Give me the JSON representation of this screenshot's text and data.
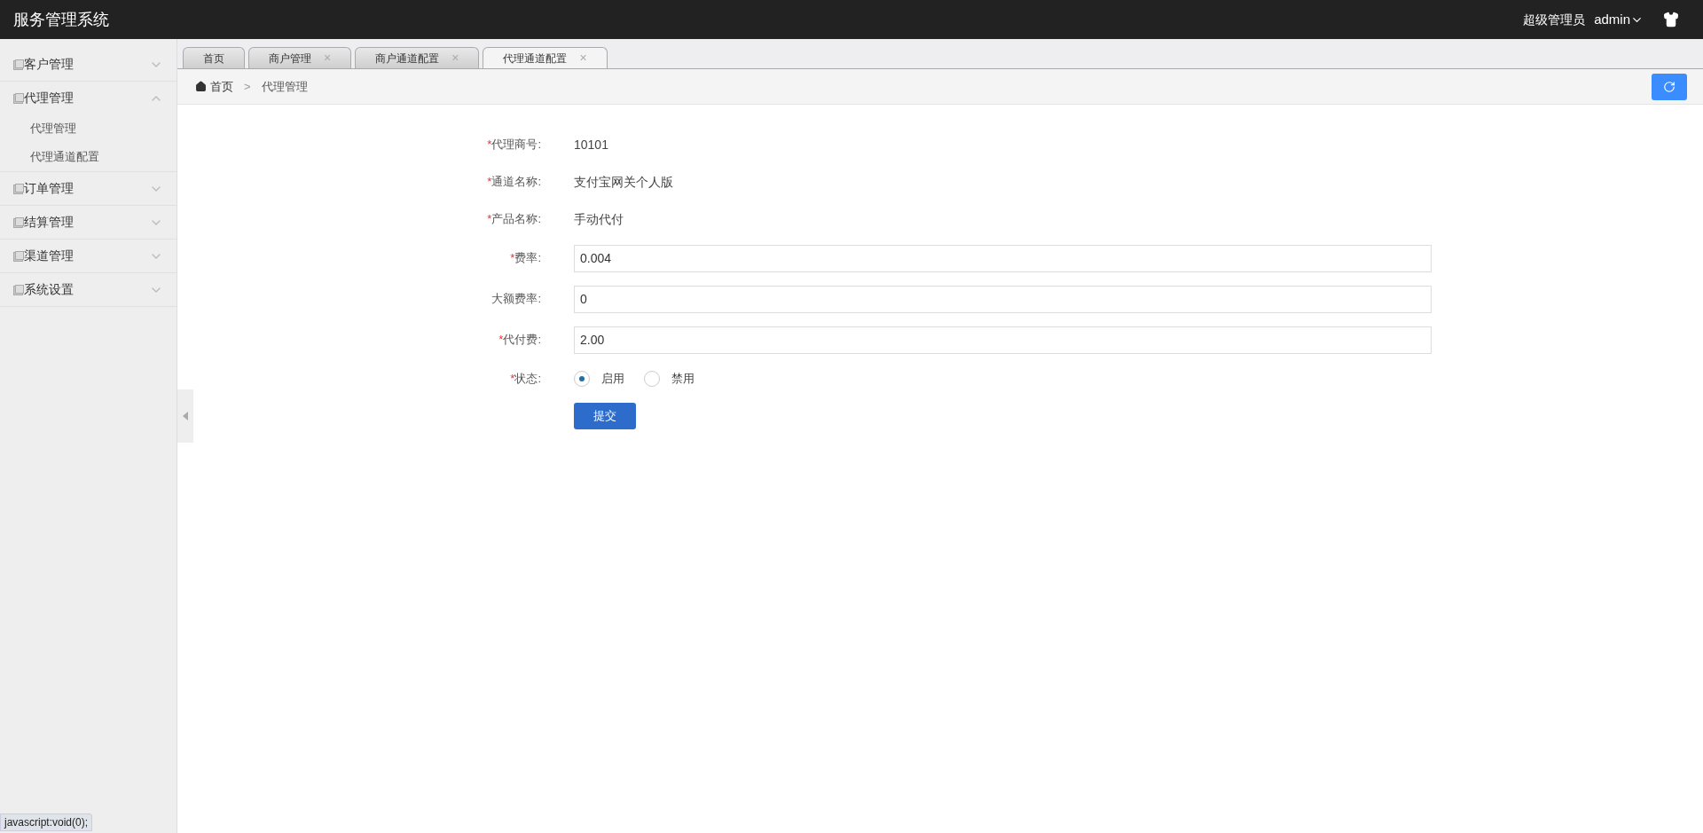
{
  "header": {
    "title": "服务管理系统",
    "role": "超级管理员",
    "user": "admin"
  },
  "sidebar": {
    "items": [
      {
        "label": "客户管理",
        "expanded": false
      },
      {
        "label": "代理管理",
        "expanded": true,
        "children": [
          {
            "label": "代理管理"
          },
          {
            "label": "代理通道配置"
          }
        ]
      },
      {
        "label": "订单管理",
        "expanded": false
      },
      {
        "label": "结算管理",
        "expanded": false
      },
      {
        "label": "渠道管理",
        "expanded": false
      },
      {
        "label": "系统设置",
        "expanded": false
      }
    ]
  },
  "tabs": [
    {
      "label": "首页",
      "closable": false,
      "selected": false
    },
    {
      "label": "商户管理",
      "closable": true,
      "selected": false
    },
    {
      "label": "商户通道配置",
      "closable": true,
      "selected": false
    },
    {
      "label": "代理通道配置",
      "closable": true,
      "selected": true
    }
  ],
  "close_glyph": "×",
  "breadcrumb": {
    "home": "首页",
    "separator": ">",
    "current": "代理管理"
  },
  "form": {
    "fields": [
      {
        "kind": "text",
        "label": "代理商号:",
        "required": true,
        "value": "10101"
      },
      {
        "kind": "text",
        "label": "通道名称:",
        "required": true,
        "value": "支付宝网关个人版"
      },
      {
        "kind": "text",
        "label": "产品名称:",
        "required": true,
        "value": "手动代付"
      },
      {
        "kind": "input",
        "label": "费率:",
        "required": true,
        "value": "0.004"
      },
      {
        "kind": "input",
        "label": "大额费率:",
        "required": false,
        "value": "0"
      },
      {
        "kind": "input",
        "label": "代付费:",
        "required": true,
        "value": "2.00"
      },
      {
        "kind": "radio",
        "label": "状态:",
        "required": true,
        "options": [
          {
            "label": "启用",
            "selected": true
          },
          {
            "label": "禁用",
            "selected": false
          }
        ]
      }
    ],
    "required_mark": "*",
    "submit": "提交"
  },
  "status_bar": "javascript:void(0);"
}
